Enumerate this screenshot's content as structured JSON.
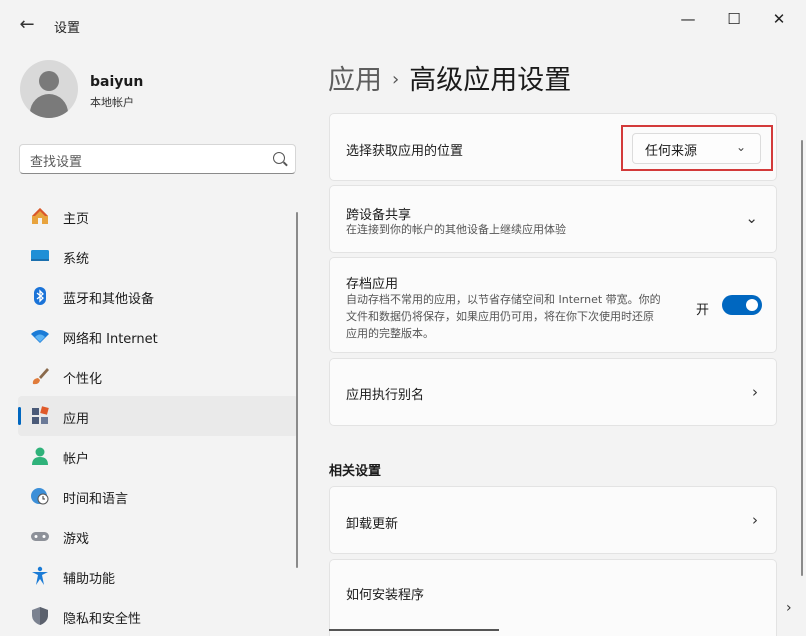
{
  "window": {
    "title": "设置",
    "back_icon": "back-arrow-icon",
    "controls": [
      "minimize-icon",
      "maximize-icon",
      "close-icon"
    ]
  },
  "profile": {
    "name": "baiyun",
    "account_type": "本地帐户"
  },
  "search": {
    "placeholder": "查找设置"
  },
  "sidebar": {
    "items": [
      {
        "label": "主页",
        "icon": "home-icon"
      },
      {
        "label": "系统",
        "icon": "system-icon"
      },
      {
        "label": "蓝牙和其他设备",
        "icon": "bluetooth-icon"
      },
      {
        "label": "网络和 Internet",
        "icon": "wifi-icon"
      },
      {
        "label": "个性化",
        "icon": "brush-icon"
      },
      {
        "label": "应用",
        "icon": "apps-icon",
        "active": true
      },
      {
        "label": "帐户",
        "icon": "account-icon"
      },
      {
        "label": "时间和语言",
        "icon": "globe-clock-icon"
      },
      {
        "label": "游戏",
        "icon": "gamepad-icon"
      },
      {
        "label": "辅助功能",
        "icon": "accessibility-icon"
      },
      {
        "label": "隐私和安全性",
        "icon": "shield-icon"
      }
    ]
  },
  "breadcrumb": {
    "parent": "应用",
    "separator": "›",
    "current": "高级应用设置"
  },
  "settings": {
    "choose_location": {
      "title": "选择获取应用的位置",
      "value": "任何来源"
    },
    "cross_device": {
      "title": "跨设备共享",
      "description": "在连接到你的帐户的其他设备上继续应用体验"
    },
    "archive": {
      "title": "存档应用",
      "description": "自动存档不常用的应用，以节省存储空间和 Internet 带宽。你的文件和数据仍将保存，如果应用仍可用，将在你下次使用时还原应用的完整版本。",
      "state_label": "开",
      "enabled": true
    },
    "aliases": {
      "title": "应用执行别名"
    }
  },
  "related": {
    "heading": "相关设置",
    "items": [
      {
        "title": "卸载更新"
      },
      {
        "title": "如何安装程序"
      }
    ]
  },
  "colors": {
    "accent": "#0067c0",
    "highlight": "#d33a3a"
  }
}
